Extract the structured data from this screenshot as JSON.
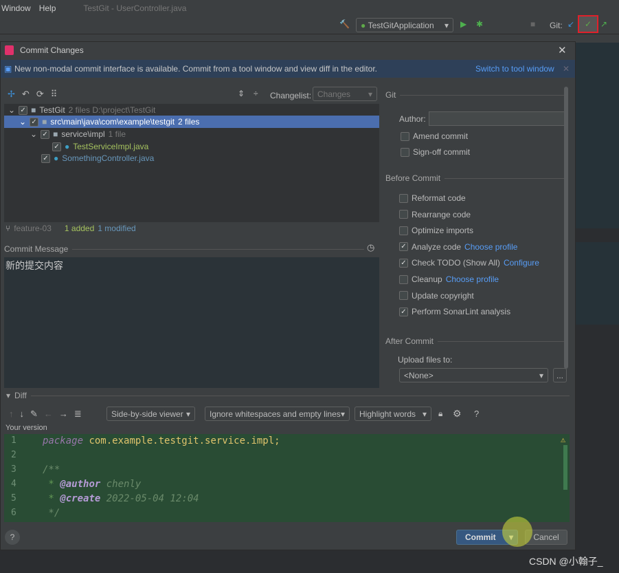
{
  "menubar": {
    "items": [
      "Window",
      "Help"
    ],
    "title": "TestGit - UserController.java"
  },
  "toolbar": {
    "run_config": "TestGitApplication",
    "git_label": "Git:"
  },
  "dialog": {
    "title": "Commit Changes",
    "info": {
      "text": "New non-modal commit interface is available. Commit from a tool window and view diff in the editor.",
      "link": "Switch to tool window"
    },
    "changelist_label": "Changelist:",
    "changelist_value": "Changes",
    "tree": [
      {
        "name": "TestGit",
        "meta": "2 files  D:\\project\\TestGit",
        "checked": true
      },
      {
        "name": "src\\main\\java\\com\\example\\testgit",
        "meta": "2 files",
        "checked": true,
        "selected": true
      },
      {
        "name": "service\\impl",
        "meta": "1 file",
        "checked": true
      },
      {
        "name": "TestServiceImpl.java",
        "checked": true,
        "status": "added"
      },
      {
        "name": "SomethingController.java",
        "checked": true,
        "status": "modified"
      }
    ],
    "branch": "feature-03",
    "added": "1 added",
    "modified": "1 modified",
    "commit_message_label": "Commit Message",
    "commit_message": "新的提交内容",
    "git": {
      "section": "Git",
      "author_label": "Author:",
      "author_value": "",
      "amend": "Amend commit",
      "signoff": "Sign-off commit"
    },
    "before_commit": {
      "section": "Before Commit",
      "items": [
        {
          "label": "Reformat code",
          "checked": false,
          "link": ""
        },
        {
          "label": "Rearrange code",
          "checked": false,
          "link": ""
        },
        {
          "label": "Optimize imports",
          "checked": false,
          "link": ""
        },
        {
          "label": "Analyze code",
          "checked": true,
          "link": "Choose profile"
        },
        {
          "label": "Check TODO (Show All)",
          "checked": true,
          "link": "Configure"
        },
        {
          "label": "Cleanup",
          "checked": false,
          "link": "Choose profile"
        },
        {
          "label": "Update copyright",
          "checked": false,
          "link": ""
        },
        {
          "label": "Perform SonarLint analysis",
          "checked": true,
          "link": ""
        }
      ]
    },
    "after_commit": {
      "section": "After Commit",
      "upload_label": "Upload files to:",
      "upload_value": "<None>",
      "more": "..."
    },
    "diff": {
      "label": "Diff",
      "viewer": "Side-by-side viewer",
      "whitespace": "Ignore whitespaces and empty lines",
      "highlight": "Highlight words",
      "your_version": "Your version",
      "lines": [
        {
          "n": "1",
          "kw": "package",
          "rest": " com.example.testgit.service.impl;"
        },
        {
          "n": "2",
          "kw": "",
          "rest": ""
        },
        {
          "n": "3",
          "kw": "",
          "rest": "/**"
        },
        {
          "n": "4",
          "kw": "@author",
          "rest": " chenly"
        },
        {
          "n": "5",
          "kw": "@create",
          "rest": " 2022-05-04 12:04"
        },
        {
          "n": "6",
          "kw": "",
          "rest": " */"
        }
      ]
    },
    "commit_button": "Commit",
    "cancel_button": "Cancel",
    "help": "?"
  },
  "watermark": "CSDN @小翰子_",
  "colors": {
    "accent": "#4b6eaf",
    "diff_bg": "#294c34",
    "link": "#589df6",
    "added": "#a6c35f",
    "modified": "#6897bb"
  }
}
